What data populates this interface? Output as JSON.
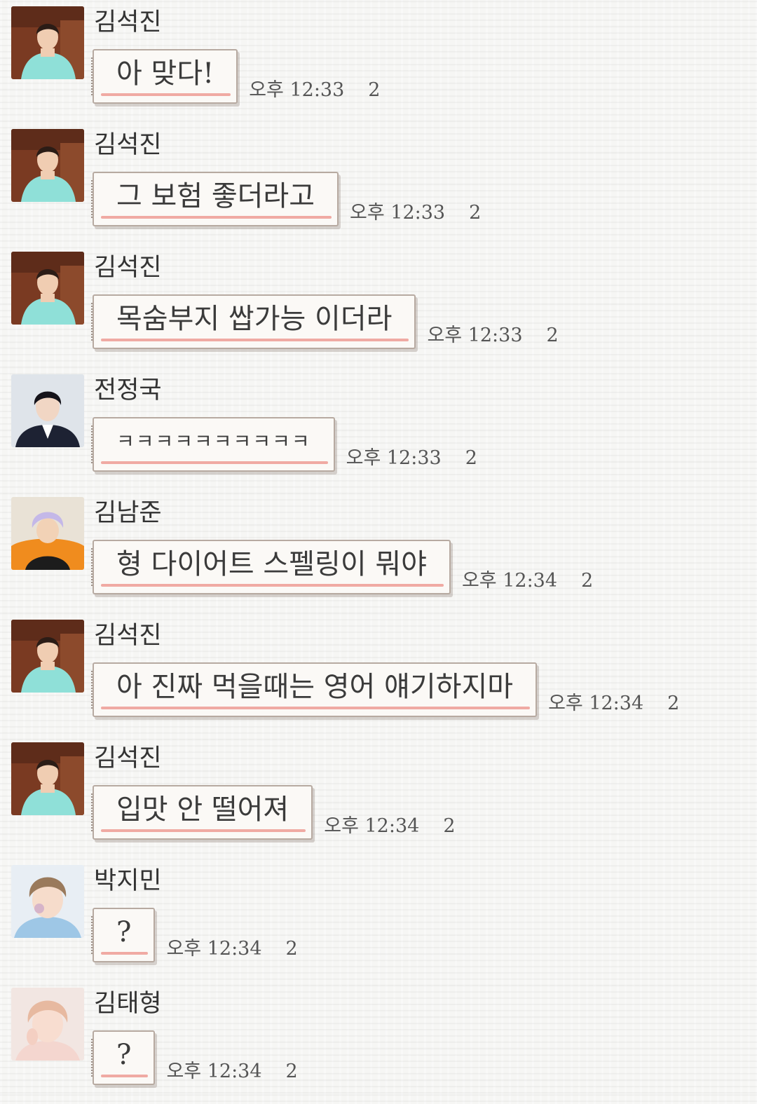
{
  "messages": [
    {
      "sender": "김석진",
      "avatar": "avatar-jin",
      "text": "아 맞다!",
      "time": "오후 12:33",
      "unread": "2"
    },
    {
      "sender": "김석진",
      "avatar": "avatar-jin",
      "text": "그 보험 좋더라고",
      "time": "오후 12:33",
      "unread": "2"
    },
    {
      "sender": "김석진",
      "avatar": "avatar-jin",
      "text": "목숨부지 쌉가능 이더라",
      "time": "오후 12:33",
      "unread": "2"
    },
    {
      "sender": "전정국",
      "avatar": "avatar-jungkook",
      "text": "ㅋㅋㅋㅋㅋㅋㅋㅋㅋㅋ",
      "time": "오후 12:33",
      "unread": "2"
    },
    {
      "sender": "김남준",
      "avatar": "avatar-namjoon",
      "text": "형 다이어트 스펠링이 뭐야",
      "time": "오후 12:34",
      "unread": "2"
    },
    {
      "sender": "김석진",
      "avatar": "avatar-jin",
      "text": "아 진짜 먹을때는 영어 얘기하지마",
      "time": "오후 12:34",
      "unread": "2"
    },
    {
      "sender": "김석진",
      "avatar": "avatar-jin",
      "text": "입맛 안 떨어져",
      "time": "오후 12:34",
      "unread": "2"
    },
    {
      "sender": "박지민",
      "avatar": "avatar-jimin",
      "text": "?",
      "time": "오후 12:34",
      "unread": "2"
    },
    {
      "sender": "김태형",
      "avatar": "avatar-taehyung",
      "text": "?",
      "time": "오후 12:34",
      "unread": "2"
    }
  ],
  "colors": {
    "bubble_underline": "#f0aaa3",
    "bubble_border": "#b7aaa1",
    "bubble_fill": "#fbf9f6"
  }
}
